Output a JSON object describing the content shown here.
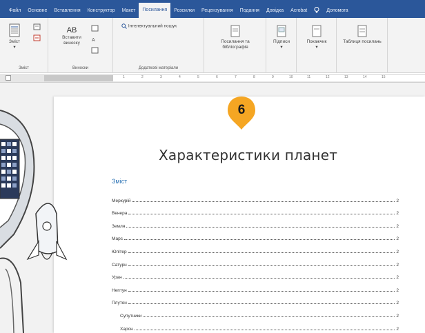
{
  "ribbon": {
    "tabs": [
      {
        "label": "Файл",
        "active": false
      },
      {
        "label": "Основне",
        "active": false
      },
      {
        "label": "Вставлення",
        "active": false
      },
      {
        "label": "Конструктор",
        "active": false
      },
      {
        "label": "Макет",
        "active": false
      },
      {
        "label": "Посилання",
        "active": true
      },
      {
        "label": "Розсилки",
        "active": false
      },
      {
        "label": "Рецензування",
        "active": false
      },
      {
        "label": "Подання",
        "active": false
      },
      {
        "label": "Довідка",
        "active": false
      },
      {
        "label": "Acrobat",
        "active": false
      },
      {
        "label": "Допомога",
        "active": false
      }
    ],
    "groups": {
      "toc": {
        "label": "Зміст",
        "button": "Зміст"
      },
      "footnotes": {
        "label": "Виноски",
        "insert_button": "Вставити виноску",
        "ab_glyph": "AB"
      },
      "research": {
        "label": "Додаткові матеріали",
        "smart_lookup": "Інтелектуальний пошук"
      },
      "citations": {
        "button": "Посилання та бібліографія"
      },
      "captions": {
        "button": "Підписи"
      },
      "index": {
        "button": "Покажчик"
      },
      "authorities": {
        "button": "Таблиця посилань"
      }
    }
  },
  "ruler": {
    "ticks": [
      "1",
      "2",
      "3",
      "4",
      "5",
      "6",
      "7",
      "8",
      "9",
      "10",
      "11",
      "12",
      "13",
      "14",
      "15"
    ]
  },
  "badge": {
    "number": "6",
    "color": "#f5a623"
  },
  "document": {
    "title": "Характеристики планет",
    "toc_heading": "Зміст",
    "toc_entries": [
      {
        "name": "Меркурій",
        "page": "2",
        "level": 1
      },
      {
        "name": "Венера",
        "page": "2",
        "level": 1
      },
      {
        "name": "Земля",
        "page": "2",
        "level": 1
      },
      {
        "name": "Марс",
        "page": "2",
        "level": 1
      },
      {
        "name": "Юпітер",
        "page": "2",
        "level": 1
      },
      {
        "name": "Сатурн",
        "page": "2",
        "level": 1
      },
      {
        "name": "Уран",
        "page": "2",
        "level": 1
      },
      {
        "name": "Нептун",
        "page": "2",
        "level": 1
      },
      {
        "name": "Плутон",
        "page": "2",
        "level": 1
      },
      {
        "name": "Супутники",
        "page": "2",
        "level": 2
      },
      {
        "name": "Харон",
        "page": "2",
        "level": 2
      }
    ]
  },
  "colors": {
    "ribbon_tab_bar": "#2b579a",
    "toc_heading": "#2e74b5",
    "badge": "#f5a623"
  }
}
